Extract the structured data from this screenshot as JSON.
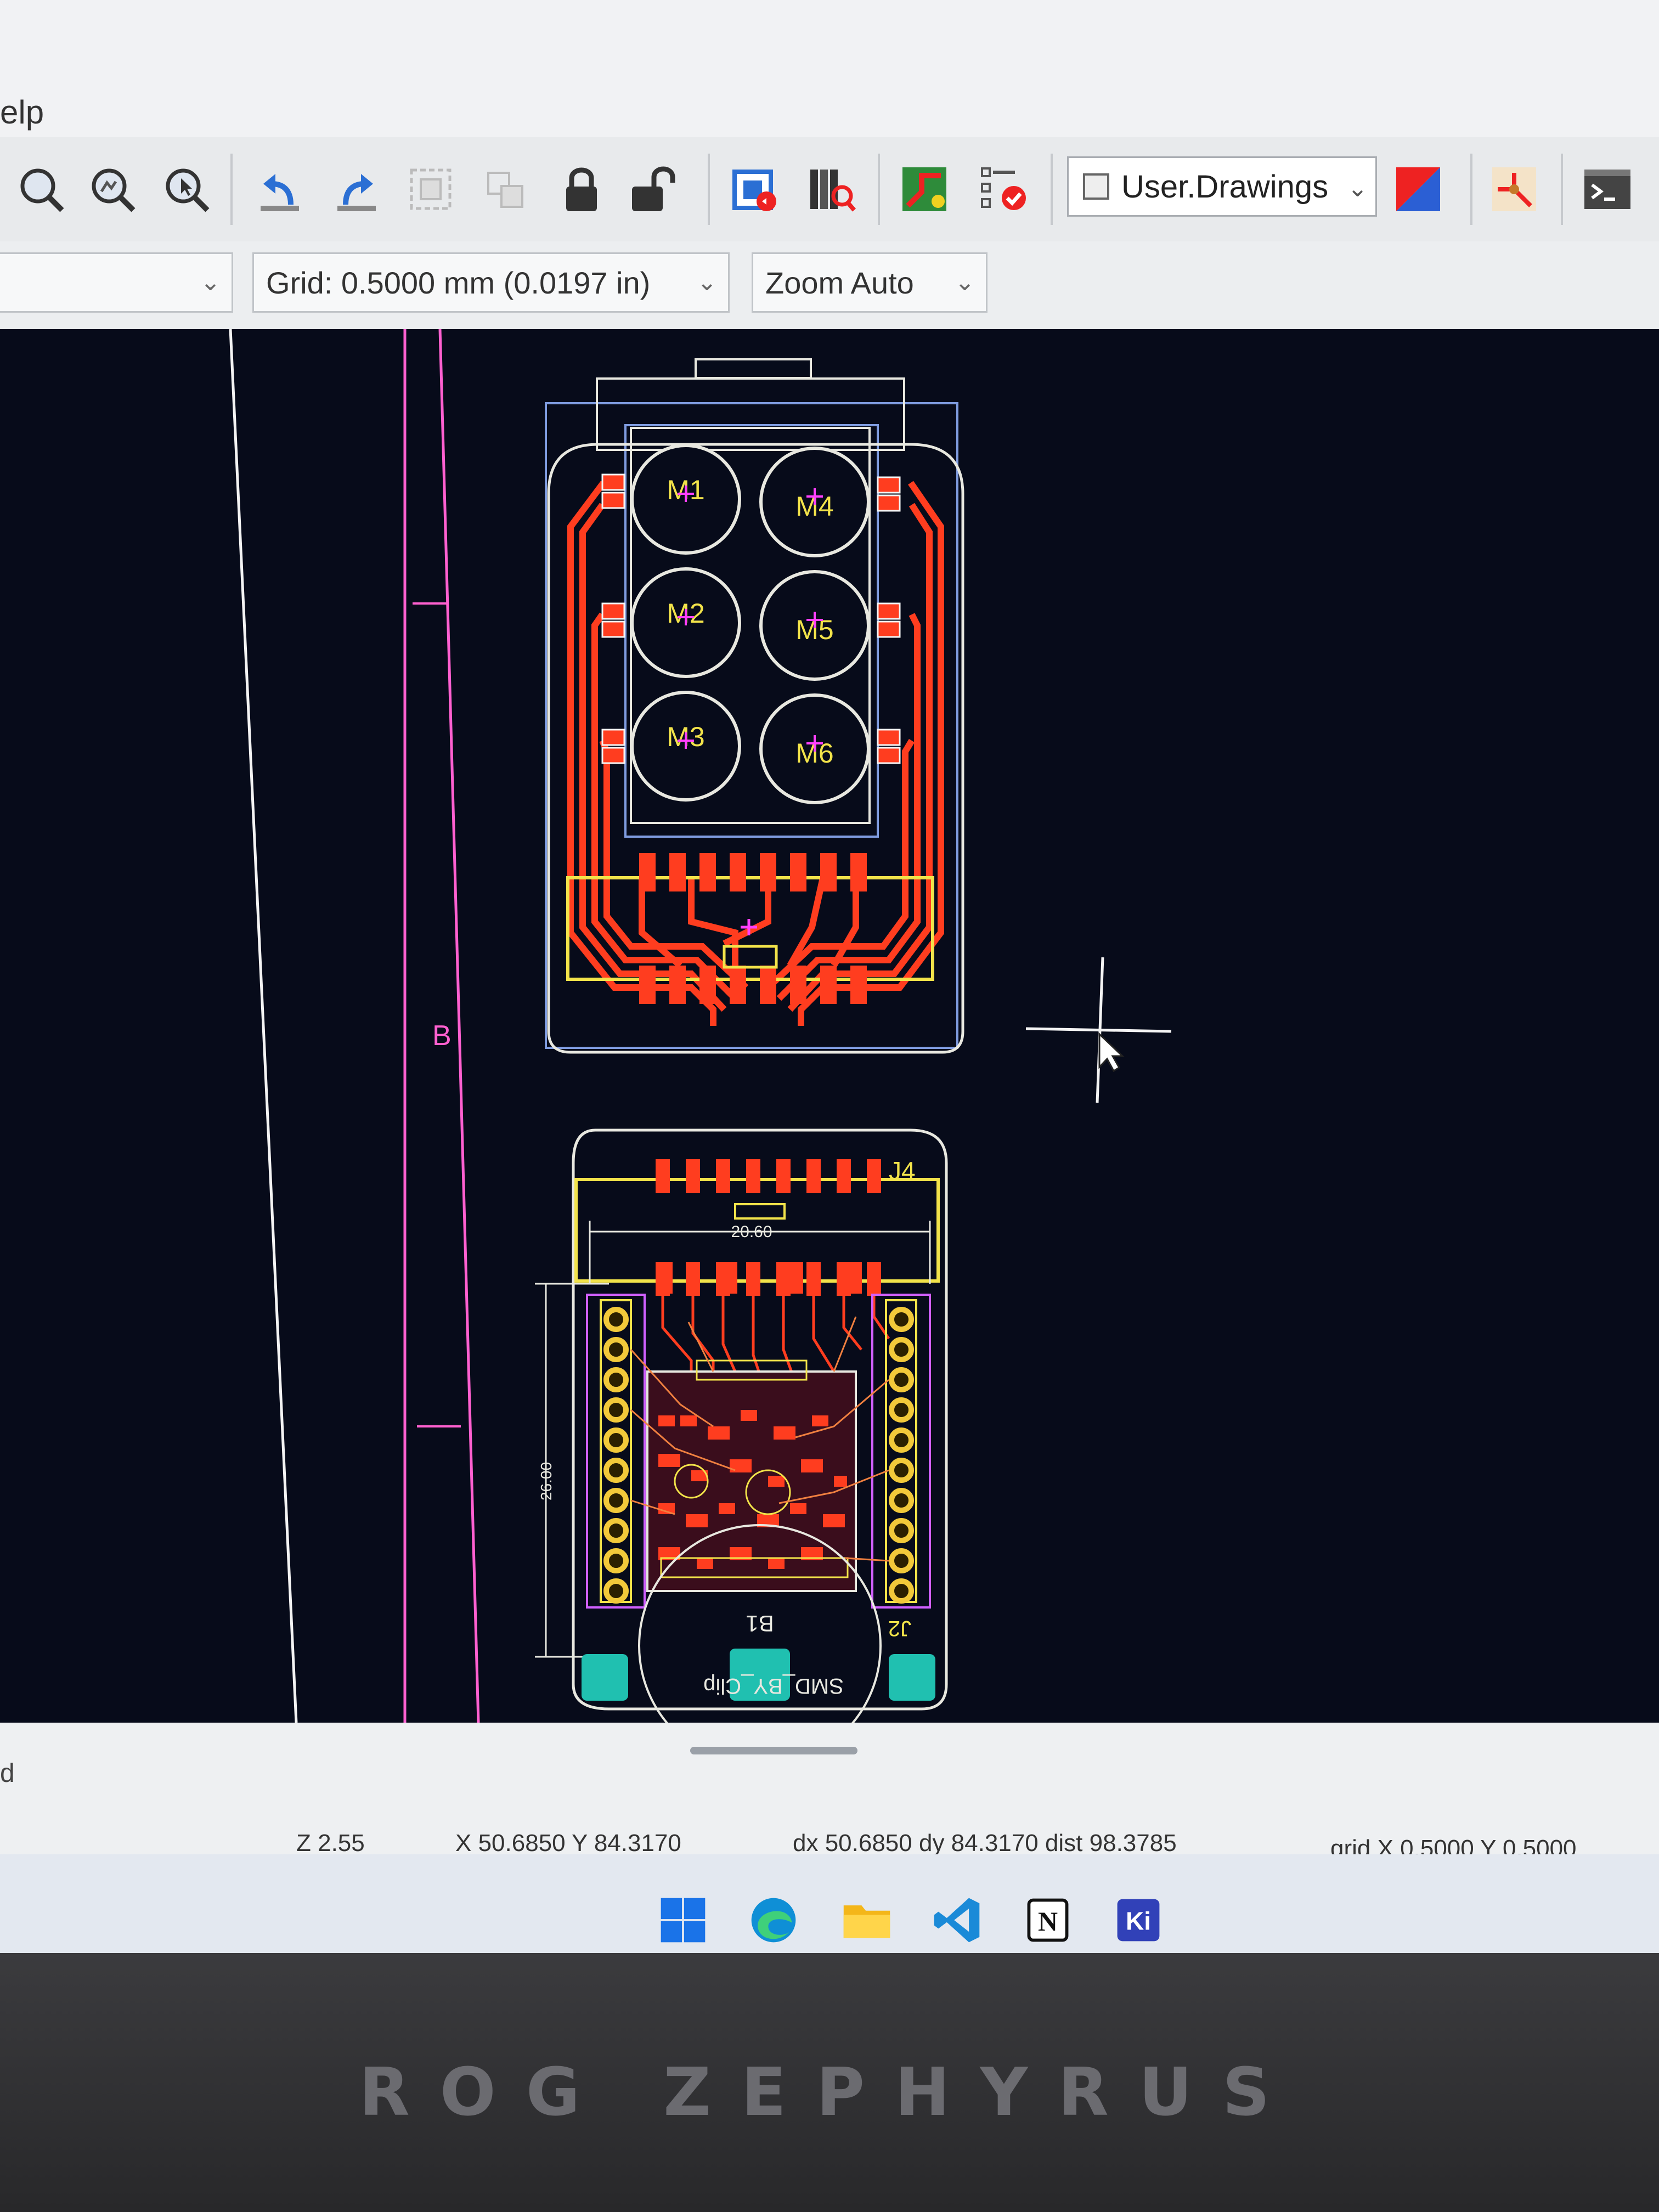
{
  "menu": {
    "help": "elp"
  },
  "toolbar": {
    "buttons": [
      "zoom-fit",
      "zoom-in",
      "zoom-selection",
      "undo",
      "redo",
      "group",
      "ungroup",
      "lock",
      "unlock",
      "net-inspector",
      "library-browser",
      "route-tracks",
      "drc"
    ],
    "layer_selector": {
      "label": "User.Drawings"
    }
  },
  "selbar": {
    "grid": "Grid: 0.5000 mm (0.0197 in)",
    "zoom": "Zoom Auto"
  },
  "canvas": {
    "sheet_label": "B",
    "motors": [
      "M1",
      "M2",
      "M3",
      "M4",
      "M5",
      "M6"
    ],
    "ref_j4": "J4",
    "ref_b1": "B1",
    "ref_j2": "J2",
    "dim_h": "20.60",
    "dim_v": "26.00",
    "footprint_label": "SMD_BY_Clip",
    "colors": {
      "background": "#070b1a",
      "copper_front": "#ff3d1f",
      "silk": "#f2e34a",
      "edge": "#e8e8e0",
      "courtyard": "#8aa4e0",
      "page_border": "#ff60d0"
    }
  },
  "status": {
    "left_msg": "d",
    "zoom": "Z 2.55",
    "xy": "X 50.6850  Y 84.3170",
    "delta": "dx 50.6850  dy 84.3170  dist 98.3785",
    "grid": "grid X 0.5000  Y 0.5000"
  },
  "taskbar": {
    "apps": [
      "windows-start",
      "edge",
      "file-explorer",
      "vscode",
      "notion",
      "kicad"
    ],
    "kicad_label": "Ki",
    "notion_label": "N"
  },
  "bezel": {
    "brand": "ROG ZEPHYRUS"
  }
}
